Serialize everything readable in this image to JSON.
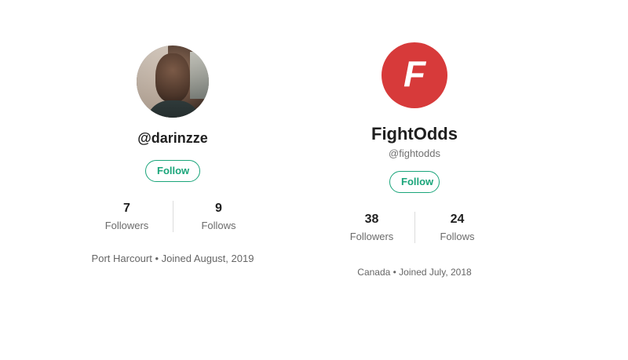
{
  "profiles": [
    {
      "handle": "@darinzze",
      "follow_label": "Follow",
      "stats": [
        {
          "value": "7",
          "label": "Followers"
        },
        {
          "value": "9",
          "label": "Follows"
        }
      ],
      "meta": "Port Harcourt • Joined August, 2019"
    },
    {
      "name": "FightOdds",
      "handle": "@fightodds",
      "logo_letter": "F",
      "logo_color": "#d73a3a",
      "follow_label": "Follow",
      "stats": [
        {
          "value": "38",
          "label": "Followers"
        },
        {
          "value": "24",
          "label": "Follows"
        }
      ],
      "meta": "Canada • Joined July, 2018"
    }
  ],
  "colors": {
    "accent": "#1aa57a",
    "text_primary": "#1f1f1f",
    "text_secondary": "#6b6b6b"
  }
}
